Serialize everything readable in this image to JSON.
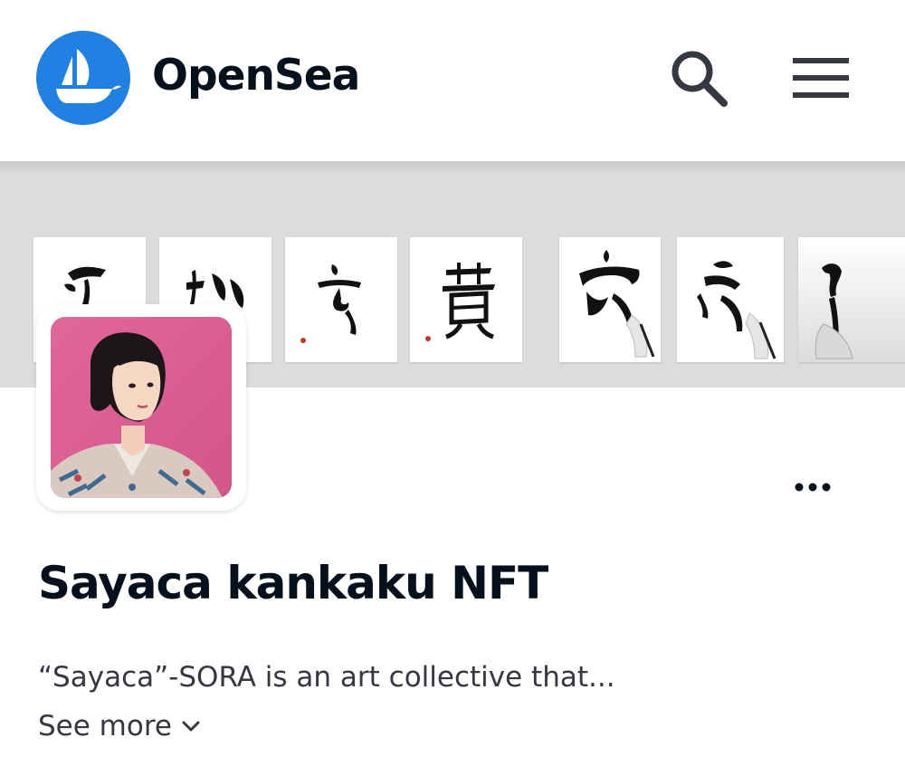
{
  "header": {
    "brand": "OpenSea",
    "logo_icon": "opensea-boat-icon",
    "search_icon": "search-icon",
    "menu_icon": "hamburger-menu-icon",
    "accent_color": "#2081e2"
  },
  "collection": {
    "name": "Sayaca kankaku NFT",
    "description": "“Sayaca”-SORA is an art collective that...",
    "see_more": "See more",
    "more_icon": "more-options-icon",
    "see_more_icon": "chevron-down-icon"
  }
}
